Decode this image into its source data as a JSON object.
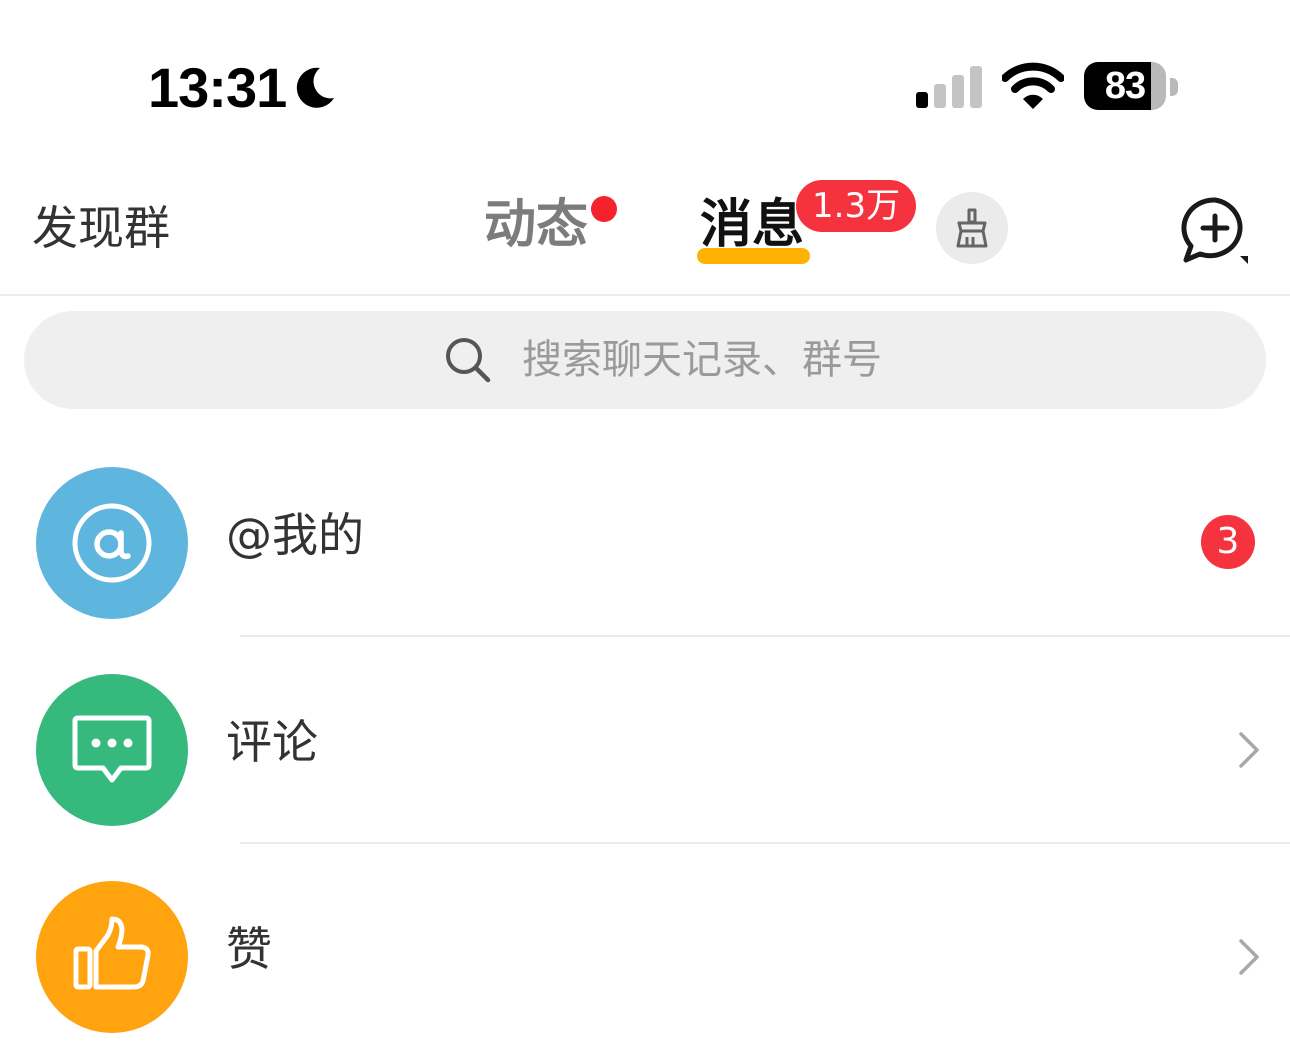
{
  "status_bar": {
    "time": "13:31",
    "battery": "83"
  },
  "nav": {
    "discover_label": "发现群",
    "tabs": [
      {
        "label": "动态",
        "active": false,
        "has_dot": true
      },
      {
        "label": "消息",
        "active": true,
        "badge": "1.3万"
      }
    ]
  },
  "search": {
    "placeholder": "搜索聊天记录、群号",
    "value": ""
  },
  "list": [
    {
      "label": "@我的",
      "icon": "at-icon",
      "color": "#5eb5dd",
      "badge": "3"
    },
    {
      "label": "评论",
      "icon": "comment-icon",
      "color": "#35b97d"
    },
    {
      "label": "赞",
      "icon": "thumbs-up-icon",
      "color": "#ffa30f"
    }
  ],
  "colors": {
    "accent": "#ffb300",
    "badge": "#f5333f"
  }
}
